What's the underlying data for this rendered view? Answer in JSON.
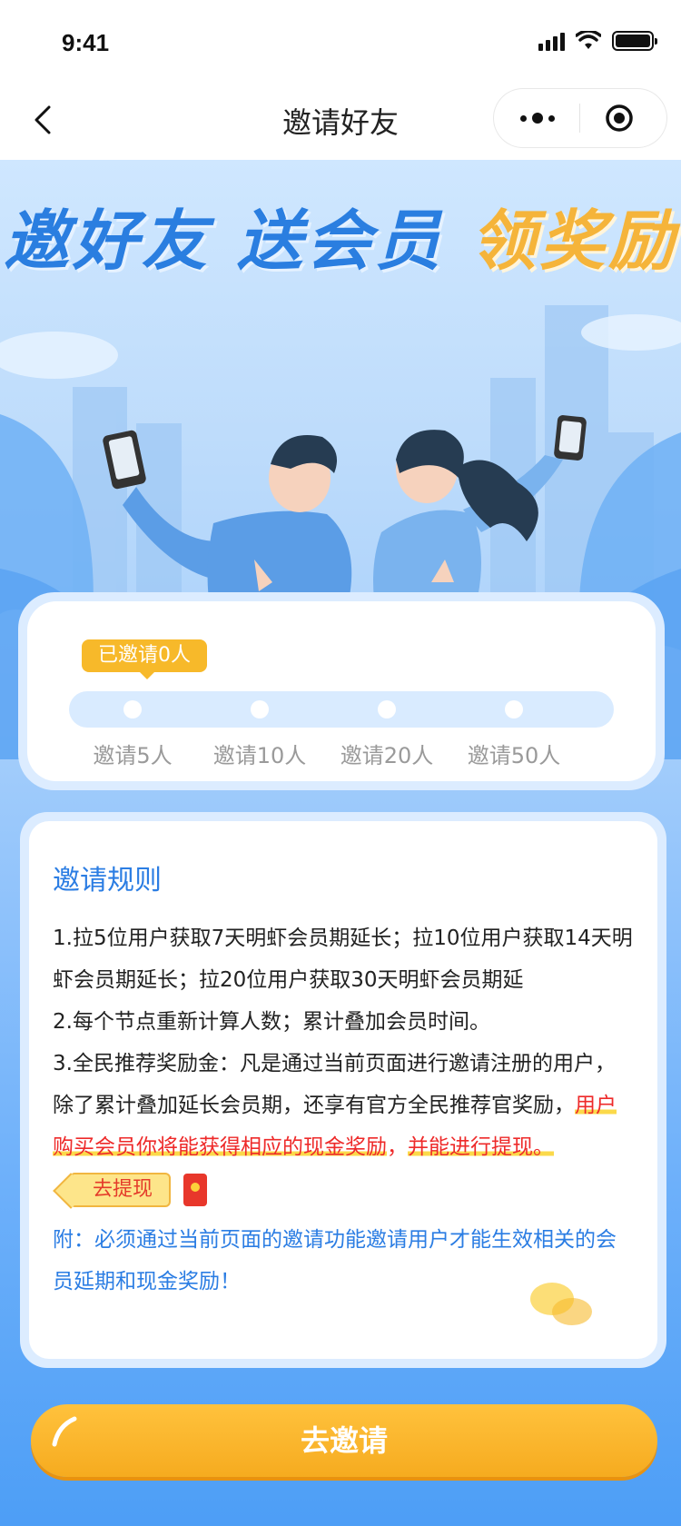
{
  "status_bar": {
    "time": "9:41"
  },
  "nav": {
    "title": "邀请好友"
  },
  "hero": {
    "title_part1": "邀好友",
    "title_part2": "送会员",
    "title_part3": "领奖励"
  },
  "progress": {
    "invited_label": "已邀请0人",
    "invited_count": 0,
    "milestones": [
      "邀请5人",
      "邀请10人",
      "邀请20人",
      "邀请50人"
    ]
  },
  "rules": {
    "title": "邀请规则",
    "rule1": "1.拉5位用户获取7天明虾会员期延长；拉10位用户获取14天明虾会员期延长；拉20位用户获取30天明虾会员期延",
    "rule2": "2.每个节点重新计算人数；累计叠加会员时间。",
    "rule3_prefix": "3.全民推荐奖励金：凡是通过当前页面进行邀请注册的用户，除了累计叠加延长会员期，还享有官方全民推荐官奖励，",
    "rule3_highlight1": "用户购买会员你将能获得相应的现金奖励",
    "rule3_sep": "，",
    "rule3_highlight2": "并能进行提现。",
    "withdraw_label": "去提现",
    "note": "附：必须通过当前页面的邀请功能邀请用户才能生效相关的会员延期和现金奖励！"
  },
  "cta": {
    "invite_label": "去邀请"
  },
  "colors": {
    "accent_blue": "#2b7de3",
    "accent_orange": "#f6ab1f",
    "highlight_red": "#ee2a2a"
  }
}
